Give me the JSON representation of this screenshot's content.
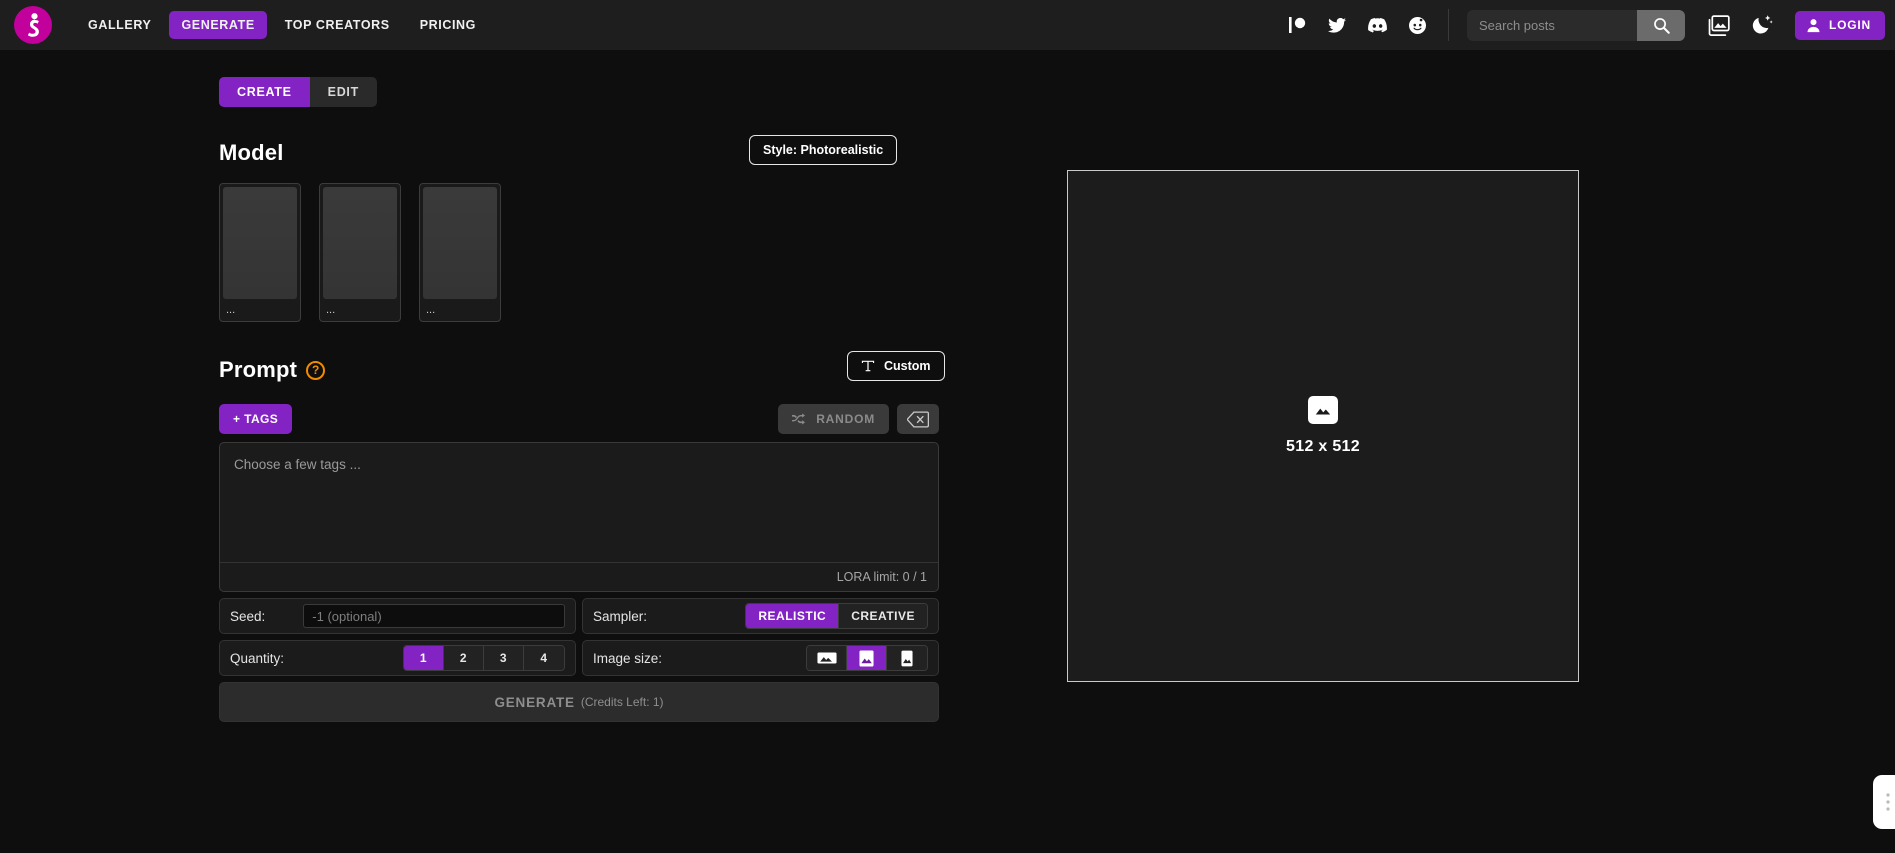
{
  "header": {
    "logo_icon": "brand-figure-logo",
    "brand_color": "#c2009b",
    "accent_color": "#8423c4",
    "nav": [
      {
        "label": "GALLERY",
        "active": false
      },
      {
        "label": "GENERATE",
        "active": true
      },
      {
        "label": "TOP CREATORS",
        "active": false
      },
      {
        "label": "PRICING",
        "active": false
      }
    ],
    "socials": [
      {
        "name": "patreon-icon"
      },
      {
        "name": "twitter-icon"
      },
      {
        "name": "discord-icon"
      },
      {
        "name": "reddit-icon"
      }
    ],
    "search": {
      "placeholder": "Search posts",
      "value": "",
      "button_icon": "search-icon"
    },
    "gallery_icon": "images-icon",
    "theme_icon": "moon-star-icon",
    "login_label": "LOGIN",
    "login_icon": "user-icon"
  },
  "main": {
    "mode_tabs": [
      {
        "label": "CREATE",
        "active": true
      },
      {
        "label": "EDIT",
        "active": false
      }
    ],
    "model": {
      "title": "Model",
      "style_badge": "Style: Photorealistic",
      "cards": [
        {
          "label": "..."
        },
        {
          "label": "..."
        },
        {
          "label": "..."
        }
      ]
    },
    "prompt": {
      "title": "Prompt",
      "help_icon": "question-circle-icon",
      "help_glyph": "?",
      "custom_label": "Custom",
      "custom_icon": "text-type-icon",
      "tags_label": "+ TAGS",
      "random_label": "RANDOM",
      "random_icon": "shuffle-icon",
      "clear_icon": "backspace-icon",
      "placeholder": "Choose a few tags ...",
      "value": "",
      "lora_limit": "LORA limit: 0 / 1"
    },
    "seed": {
      "label": "Seed:",
      "placeholder": "-1 (optional)",
      "value": ""
    },
    "sampler": {
      "label": "Sampler:",
      "options": [
        {
          "label": "REALISTIC",
          "active": true
        },
        {
          "label": "CREATIVE",
          "active": false
        }
      ]
    },
    "quantity": {
      "label": "Quantity:",
      "options": [
        {
          "label": "1",
          "active": true
        },
        {
          "label": "2",
          "active": false
        },
        {
          "label": "3",
          "active": false
        },
        {
          "label": "4",
          "active": false
        }
      ]
    },
    "image_size": {
      "label": "Image size:",
      "options": [
        {
          "icon": "landscape-image-icon",
          "active": false
        },
        {
          "icon": "square-image-icon",
          "active": true
        },
        {
          "icon": "portrait-image-icon",
          "active": false
        }
      ]
    },
    "generate": {
      "label": "GENERATE",
      "credits": "(Credits Left: 1)"
    },
    "preview": {
      "icon": "image-placeholder-icon",
      "size_label": "512 x 512"
    },
    "float_widget_icon": "vertical-dots-widget-icon"
  }
}
